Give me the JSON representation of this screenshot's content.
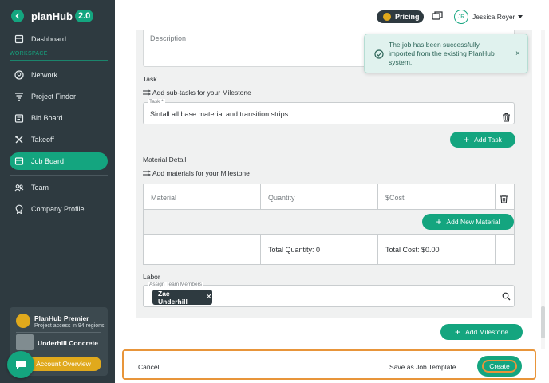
{
  "app": {
    "name": "planHub",
    "version": "2.0"
  },
  "sidebar": {
    "workspace_label": "WORKSPACE",
    "items": [
      {
        "label": "Dashboard",
        "icon": "dashboard-icon"
      },
      {
        "label": "Network",
        "icon": "user-circle-icon"
      },
      {
        "label": "Project Finder",
        "icon": "funnel-icon"
      },
      {
        "label": "Bid Board",
        "icon": "clipboard-icon"
      },
      {
        "label": "Takeoff",
        "icon": "measure-icon"
      },
      {
        "label": "Job Board",
        "icon": "board-icon",
        "active": true
      },
      {
        "label": "Team",
        "icon": "team-icon"
      },
      {
        "label": "Company Profile",
        "icon": "badge-icon"
      }
    ],
    "premier": {
      "title": "PlanHub Premier",
      "subtitle": "Project access in 94 regions",
      "company": "Underhill Concrete",
      "account_button": "Account Overview"
    }
  },
  "topbar": {
    "pricing_label": "Pricing",
    "user_initials": "JR",
    "user_name": "Jessica Royer"
  },
  "toast": {
    "message": "The job has been successfully imported from the existing PlanHub system.",
    "close": "×"
  },
  "form": {
    "description_label": "Description",
    "task": {
      "section_title": "Task",
      "add_subtasks": "Add sub-tasks for your Milestone",
      "field_label": "Task *",
      "value": "Sintall all base material and transition strips",
      "add_button": "Add Task"
    },
    "material": {
      "section_title": "Material Detail",
      "add_materials": "Add materials for your Milestone",
      "col_material": "Material",
      "col_quantity": "Quantity",
      "col_cost": "$Cost",
      "add_button": "Add New Material",
      "total_quantity": "Total Quantity: 0",
      "total_cost": "Total Cost: $0.00"
    },
    "labor": {
      "section_title": "Labor",
      "field_label": "Assign Team Members",
      "member": "Zac Underhill"
    },
    "add_milestone": "Add Milestone"
  },
  "actions": {
    "cancel": "Cancel",
    "save_template": "Save as Job Template",
    "create": "Create"
  },
  "colors": {
    "accent": "#14a57f",
    "sidebar": "#2e3a40",
    "highlight": "#e8953a",
    "gold": "#e0a91c"
  }
}
